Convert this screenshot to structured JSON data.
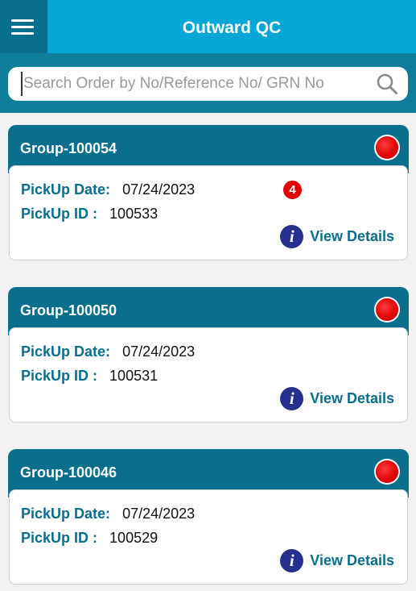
{
  "app_bar": {
    "title": "Outward QC",
    "menu_icon": "hamburger-menu-icon"
  },
  "search": {
    "placeholder": "Search Order by No/Reference No/ GRN No",
    "value": "",
    "icon": "search-icon"
  },
  "notification_badge": "4",
  "labels": {
    "pickup_date": "PickUp Date:",
    "pickup_id": "PickUp ID :",
    "view_details": "View Details"
  },
  "groups": [
    {
      "name": "Group-100054",
      "pickup_date": "07/24/2023",
      "pickup_id": "100533",
      "status_color": "#e00000"
    },
    {
      "name": "Group-100050",
      "pickup_date": "07/24/2023",
      "pickup_id": "100531",
      "status_color": "#e00000"
    },
    {
      "name": "Group-100046",
      "pickup_date": "07/24/2023",
      "pickup_id": "100529",
      "status_color": "#e00000"
    }
  ],
  "colors": {
    "app_bar": "#05a7d6",
    "header_dark": "#0a6f8d",
    "accent_text": "#0a6f8d",
    "info_icon": "#25308f"
  }
}
